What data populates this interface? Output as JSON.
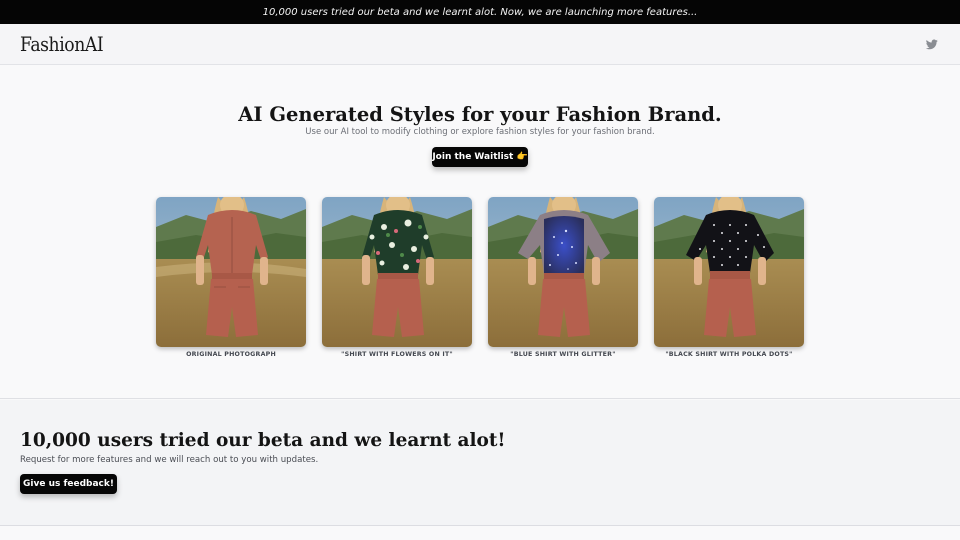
{
  "announcement": "10,000 users tried our beta and we learnt alot. Now, we are launching more features...",
  "nav": {
    "logo": "FashionAI",
    "social_icon": "twitter-icon"
  },
  "hero": {
    "title": "AI Generated Styles for your Fashion Brand.",
    "subtitle": "Use our AI tool to modify clothing or explore fashion styles for your fashion brand.",
    "cta_label": "Join the Waitlist 👉"
  },
  "gallery": [
    {
      "caption": "ORIGINAL PHOTOGRAPH",
      "shirt": "plain-rust"
    },
    {
      "caption": "\"SHIRT WITH FLOWERS ON IT\"",
      "shirt": "floral"
    },
    {
      "caption": "\"BLUE SHIRT WITH GLITTER\"",
      "shirt": "blue-glitter"
    },
    {
      "caption": "\"BLACK SHIRT WITH POLKA DOTS\"",
      "shirt": "black-polka"
    }
  ],
  "feedback": {
    "title": "10,000 users tried our beta and we learnt alot!",
    "subtitle": "Request for more features and we will reach out to you with updates.",
    "cta_label": "Give us feedback!"
  },
  "colors": {
    "announcement_bg": "#050505",
    "button_bg": "#060606",
    "shorts": "#b5604e",
    "field": "#b89a5c",
    "sky": "#8fb0c8"
  }
}
